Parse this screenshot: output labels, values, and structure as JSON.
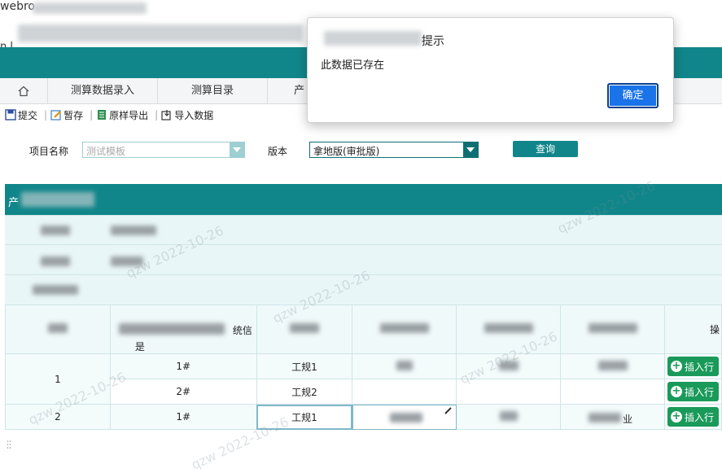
{
  "browser": {
    "title_fragment": "webro",
    "url_prefix": "n l"
  },
  "tabs": [
    {
      "label": ""
    },
    {
      "label": "测算数据录入"
    },
    {
      "label": "测算目录"
    },
    {
      "label": "产"
    }
  ],
  "toolbar": {
    "submit": "提交",
    "save_temp": "暂存",
    "export_sample": "原样导出",
    "import_data": "导入数据"
  },
  "query": {
    "project_label": "项目名称",
    "project_value": "测试模板",
    "version_label": "版本",
    "version_value": "拿地版(审批版)",
    "search_button": "查询"
  },
  "grid": {
    "header_fragment": "产",
    "header_suffix": "是",
    "header_fragment2": "统信",
    "header_last": "操",
    "rows": [
      {
        "seq": "1",
        "no": "1#",
        "code": "工规1",
        "tail": ""
      },
      {
        "seq": "",
        "no": "2#",
        "code": "工规2",
        "tail": ""
      },
      {
        "seq": "2",
        "no": "1#",
        "code": "工规1",
        "tail": "业"
      }
    ],
    "insert_label": "插入行"
  },
  "dialog": {
    "title_suffix": "提示",
    "message": "此数据已存在",
    "ok": "确定"
  },
  "watermark": "qzw 2022-10-26",
  "colors": {
    "teal": "#11868a",
    "insert_green": "#199a5a",
    "ok_blue": "#1a73e8"
  }
}
